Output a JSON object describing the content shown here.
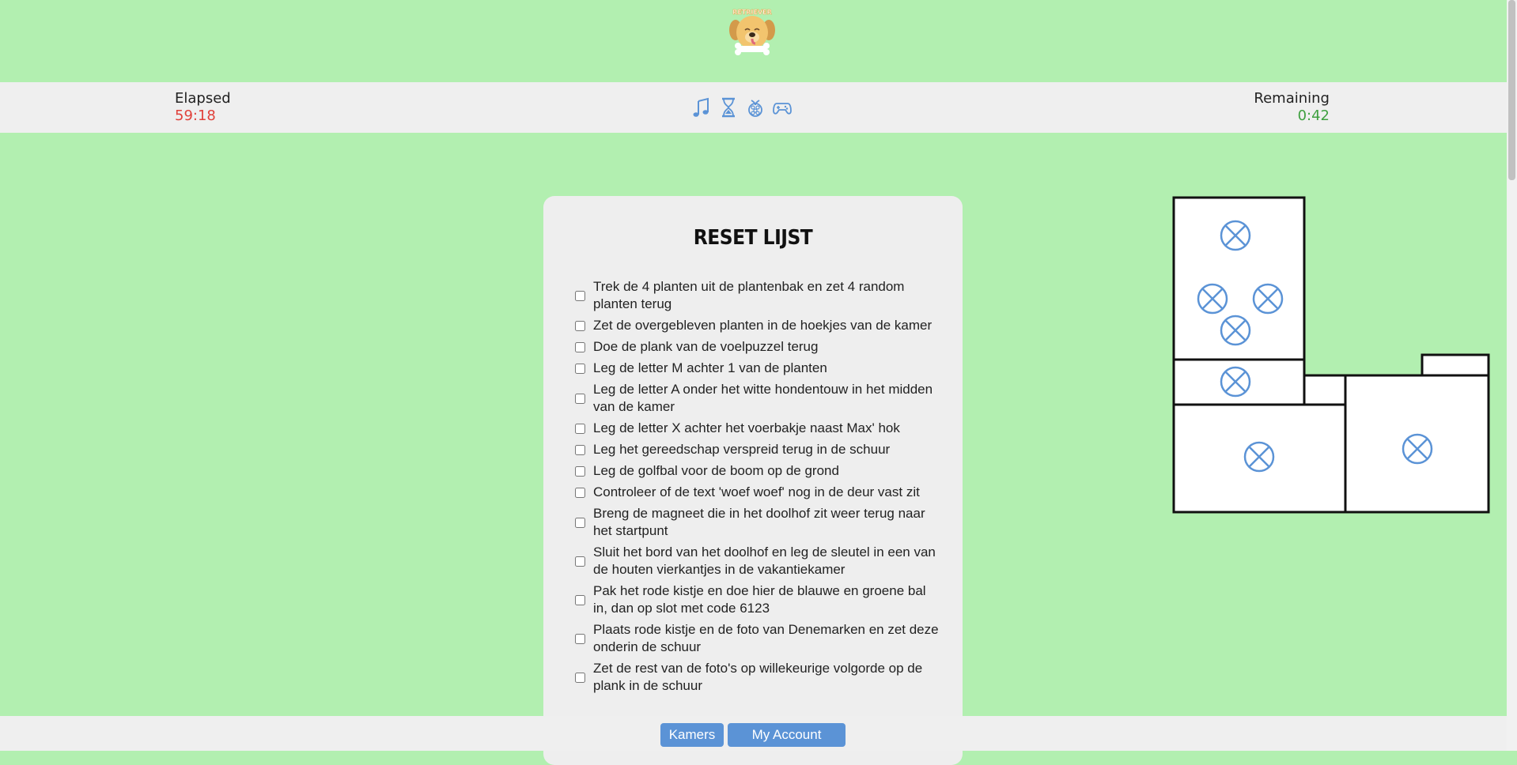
{
  "header": {
    "logo_text": "RETRIEVER"
  },
  "status": {
    "elapsed_label": "Elapsed",
    "elapsed_value": "59:18",
    "remaining_label": "Remaining",
    "remaining_value": "0:42"
  },
  "controls": [
    {
      "icon": "music-icon"
    },
    {
      "icon": "hourglass-icon"
    },
    {
      "icon": "raspberry-icon"
    },
    {
      "icon": "gamepad-icon"
    }
  ],
  "reset": {
    "title": "RESET LIJST",
    "items": [
      "Trek de 4 planten uit de plantenbak en zet 4 random planten terug",
      "Zet de overgebleven planten in de hoekjes van de kamer",
      "Doe de plank van de voelpuzzel terug",
      "Leg de letter M achter 1 van de planten",
      "Leg de letter A onder het witte hondentouw in het midden van de kamer",
      "Leg de letter X achter het voerbakje naast Max' hok",
      "Leg het gereedschap verspreid terug in de schuur",
      "Leg de golfbal voor de boom op de grond",
      "Controleer of de text 'woef woef' nog in de deur vast zit",
      "Breng de magneet die in het doolhof zit weer terug naar het startpunt",
      "Sluit het bord van het doolhof en leg de sleutel in een van de houten vierkantjes in de vakantiekamer",
      "Pak het rode kistje en doe hier de blauwe en groene bal in, dan op slot met code 6123",
      "Plaats rode kistje en de foto van Denemarken en zet deze onderin de schuur",
      "Zet de rest van de foto's op willekeurige volgorde op de plank in de schuur"
    ]
  },
  "nav": {
    "rooms_label": "Kamers",
    "account_label": "My Account"
  },
  "colors": {
    "background": "#b2efb0",
    "accent": "#5b93d6",
    "elapsed": "#e0403a",
    "remaining": "#3fa040"
  }
}
